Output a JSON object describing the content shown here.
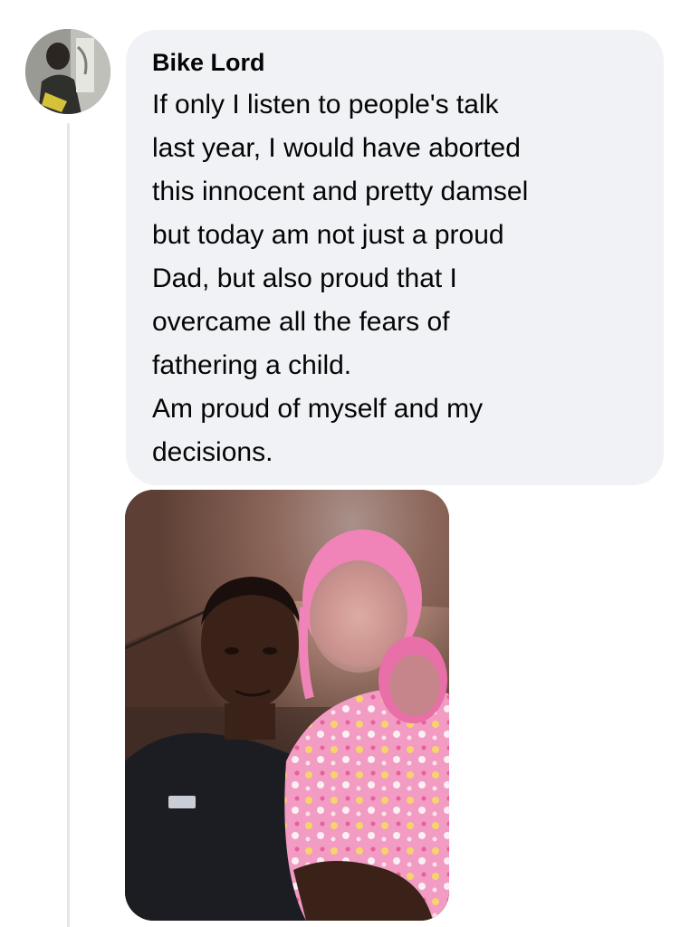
{
  "comment": {
    "author": "Bike Lord",
    "text": "If only I listen to people's talk\nlast year, I would have aborted\nthis innocent and pretty damsel\nbut today am not just a proud\nDad, but also proud that I\novercame all the fears of\nfathering a child.\nAm proud of myself and my\ndecisions.",
    "bubble_color": "#f0f2f5",
    "text_color": "#050505"
  },
  "thread": {
    "line_color": "#e4e6eb"
  },
  "attachment": {
    "kind": "photo",
    "subject": "man-holding-baby-photo"
  }
}
